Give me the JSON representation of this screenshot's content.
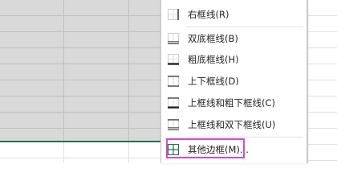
{
  "menu": {
    "items": [
      {
        "label": "右框线(R)",
        "icon": "border-right-icon"
      },
      {
        "label": "双底框线(B)",
        "icon": "border-double-bottom-icon"
      },
      {
        "label": "粗底框线(H)",
        "icon": "border-thick-bottom-icon"
      },
      {
        "label": "上下框线(D)",
        "icon": "border-top-bottom-icon"
      },
      {
        "label": "上框线和粗下框线(C)",
        "icon": "border-top-thick-bottom-icon"
      },
      {
        "label": "上框线和双下框线(U)",
        "icon": "border-top-double-bottom-icon"
      },
      {
        "label": "其他边框(M)...",
        "icon": "more-borders-icon"
      }
    ]
  },
  "colors": {
    "accent_green": "#217346",
    "highlight_magenta": "#d44bd1",
    "selection_fill": "#d9d9d9"
  }
}
